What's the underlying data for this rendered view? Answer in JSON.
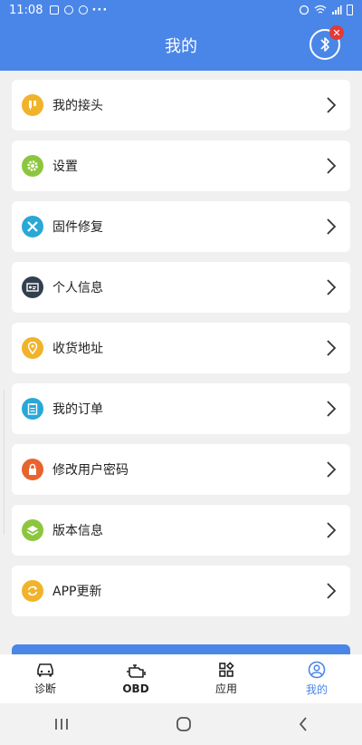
{
  "status": {
    "time": "11:08",
    "dots": "···"
  },
  "appbar": {
    "title": "我的",
    "badge": "✕"
  },
  "menu": [
    {
      "label": "我的接头",
      "icon": "connector-icon",
      "color": "#f0b32a"
    },
    {
      "label": "设置",
      "icon": "settings-icon",
      "color": "#8cc63f"
    },
    {
      "label": "固件修复",
      "icon": "tools-icon",
      "color": "#29a8d6"
    },
    {
      "label": "个人信息",
      "icon": "id-card-icon",
      "color": "#333f4f"
    },
    {
      "label": "收货地址",
      "icon": "location-icon",
      "color": "#f0b32a"
    },
    {
      "label": "我的订单",
      "icon": "clipboard-icon",
      "color": "#29a8d6"
    },
    {
      "label": "修改用户密码",
      "icon": "lock-icon",
      "color": "#e8632e"
    },
    {
      "label": "版本信息",
      "icon": "layers-icon",
      "color": "#8cc63f"
    },
    {
      "label": "APP更新",
      "icon": "refresh-icon",
      "color": "#f0b32a"
    }
  ],
  "tabs": [
    {
      "label": "诊断",
      "icon": "car-icon"
    },
    {
      "label": "OBD",
      "icon": "engine-icon"
    },
    {
      "label": "应用",
      "icon": "apps-icon"
    },
    {
      "label": "我的",
      "icon": "profile-icon",
      "active": true
    }
  ],
  "colors": {
    "primary": "#4a86e8"
  }
}
